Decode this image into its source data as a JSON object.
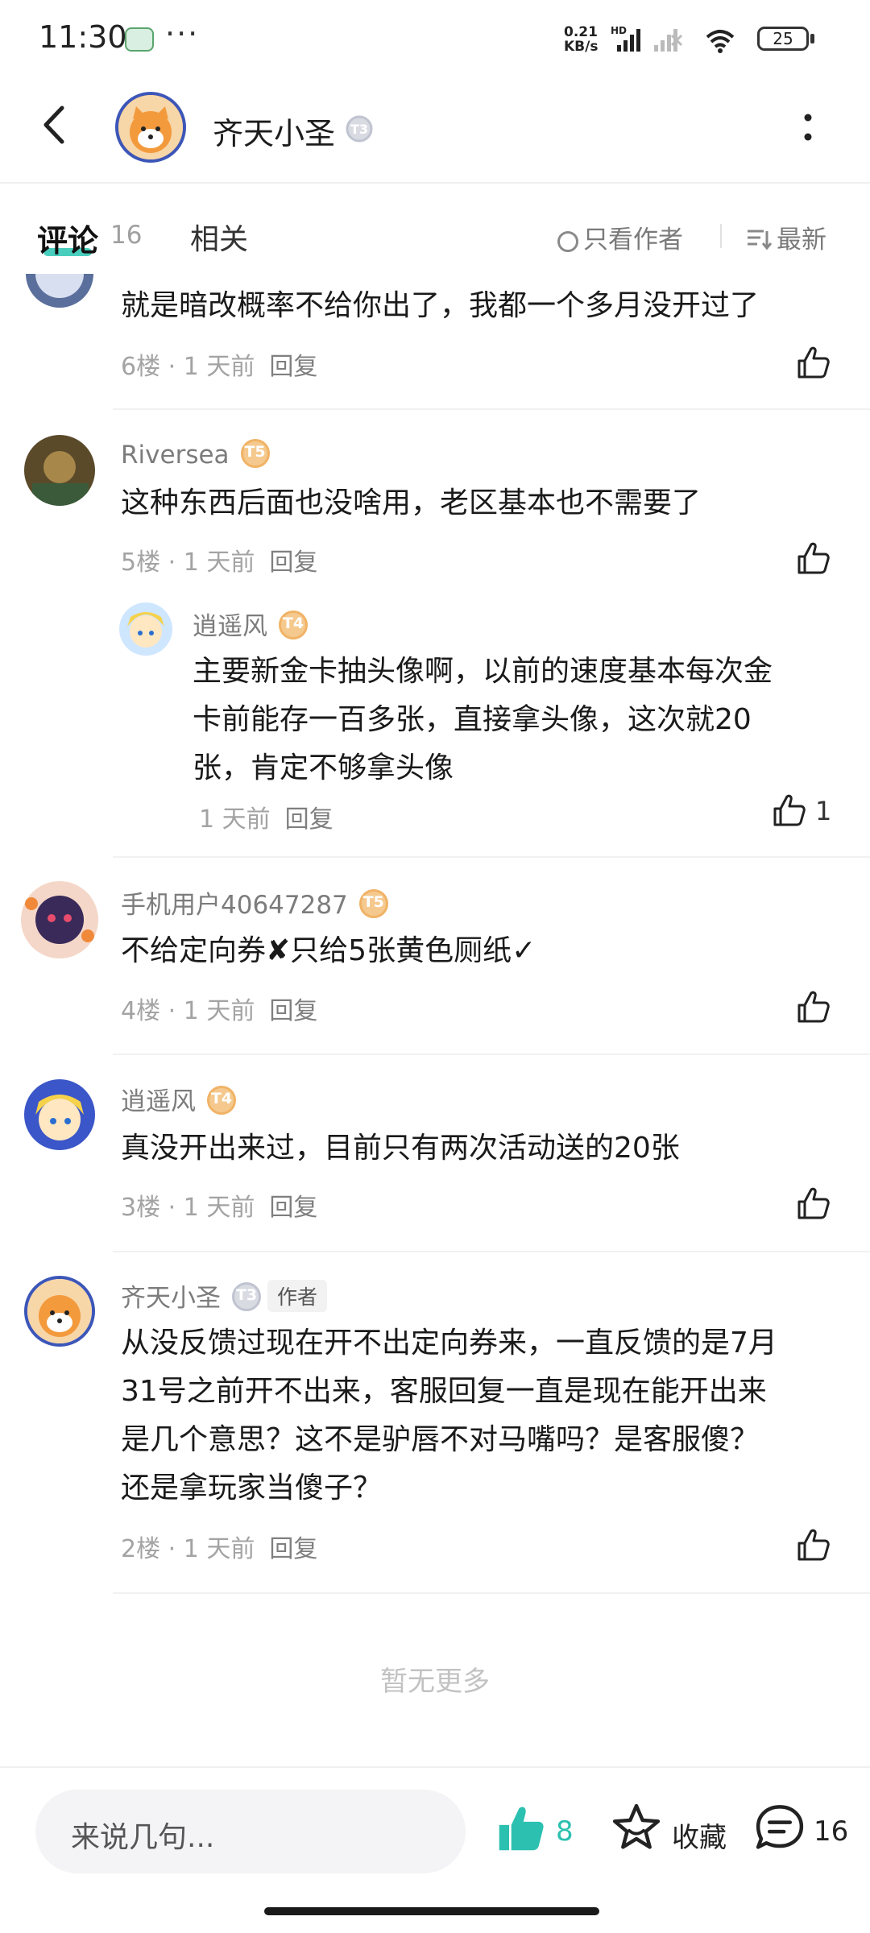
{
  "status": {
    "time": "11:30",
    "dots": "···",
    "speed_top": "0.21",
    "speed_bottom": "KB/s",
    "hd": "HD",
    "battery": "25"
  },
  "header": {
    "name": "齐天小圣",
    "badge": "T3"
  },
  "tabs": {
    "comments": "评论",
    "comments_count": "16",
    "related": "相关",
    "only_author": "只看作者",
    "sort": "最新"
  },
  "comments": [
    {
      "text": "就是暗改概率不给你出了，我都一个多月没开过了",
      "floor": "6楼",
      "time": "1 天前",
      "reply": "回复"
    },
    {
      "user": "Riversea",
      "level": "T5",
      "text": "这种东西后面也没啥用，老区基本也不需要了",
      "floor": "5楼",
      "time": "1 天前",
      "reply": "回复",
      "sub": {
        "user": "逍遥风",
        "level": "T4",
        "lines": [
          "主要新金卡抽头像啊，以前的速度基本每次金",
          "卡前能存一百多张，直接拿头像，这次就20",
          "张，肯定不够拿头像"
        ],
        "time": "1 天前",
        "reply": "回复",
        "likes": "1"
      }
    },
    {
      "user": "手机用户40647287",
      "level": "T5",
      "text": "不给定向券✘只给5张黄色厕纸✓",
      "floor": "4楼",
      "time": "1 天前",
      "reply": "回复"
    },
    {
      "user": "逍遥风",
      "level": "T4",
      "text": "真没开出来过，目前只有两次活动送的20张",
      "floor": "3楼",
      "time": "1 天前",
      "reply": "回复"
    },
    {
      "user": "齐天小圣",
      "level": "T3",
      "author_tag": "作者",
      "lines": [
        "从没反馈过现在开不出定向券来，一直反馈的是7月",
        "31号之前开不出来，客服回复一直是现在能开出来",
        "是几个意思？这不是驴唇不对马嘴吗？是客服傻？",
        "还是拿玩家当傻子？"
      ],
      "floor": "2楼",
      "time": "1 天前",
      "reply": "回复"
    }
  ],
  "no_more": "暂无更多",
  "bottom": {
    "placeholder": "来说几句...",
    "likes": "8",
    "favorite": "收藏",
    "comments": "16"
  },
  "colors": {
    "accent": "#29c6b3",
    "gold_badge": "#f5c98e",
    "silver_badge": "#d9dbe3"
  },
  "icons": [
    "back-icon",
    "more-icon",
    "like-icon",
    "star-icon",
    "comment-icon",
    "sort-icon"
  ]
}
